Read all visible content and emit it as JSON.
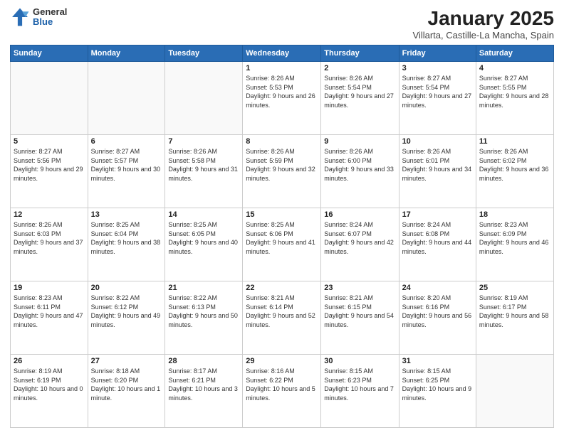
{
  "logo": {
    "general": "General",
    "blue": "Blue"
  },
  "header": {
    "month": "January 2025",
    "location": "Villarta, Castille-La Mancha, Spain"
  },
  "weekdays": [
    "Sunday",
    "Monday",
    "Tuesday",
    "Wednesday",
    "Thursday",
    "Friday",
    "Saturday"
  ],
  "weeks": [
    [
      {
        "day": "",
        "info": ""
      },
      {
        "day": "",
        "info": ""
      },
      {
        "day": "",
        "info": ""
      },
      {
        "day": "1",
        "info": "Sunrise: 8:26 AM\nSunset: 5:53 PM\nDaylight: 9 hours and 26 minutes."
      },
      {
        "day": "2",
        "info": "Sunrise: 8:26 AM\nSunset: 5:54 PM\nDaylight: 9 hours and 27 minutes."
      },
      {
        "day": "3",
        "info": "Sunrise: 8:27 AM\nSunset: 5:54 PM\nDaylight: 9 hours and 27 minutes."
      },
      {
        "day": "4",
        "info": "Sunrise: 8:27 AM\nSunset: 5:55 PM\nDaylight: 9 hours and 28 minutes."
      }
    ],
    [
      {
        "day": "5",
        "info": "Sunrise: 8:27 AM\nSunset: 5:56 PM\nDaylight: 9 hours and 29 minutes."
      },
      {
        "day": "6",
        "info": "Sunrise: 8:27 AM\nSunset: 5:57 PM\nDaylight: 9 hours and 30 minutes."
      },
      {
        "day": "7",
        "info": "Sunrise: 8:26 AM\nSunset: 5:58 PM\nDaylight: 9 hours and 31 minutes."
      },
      {
        "day": "8",
        "info": "Sunrise: 8:26 AM\nSunset: 5:59 PM\nDaylight: 9 hours and 32 minutes."
      },
      {
        "day": "9",
        "info": "Sunrise: 8:26 AM\nSunset: 6:00 PM\nDaylight: 9 hours and 33 minutes."
      },
      {
        "day": "10",
        "info": "Sunrise: 8:26 AM\nSunset: 6:01 PM\nDaylight: 9 hours and 34 minutes."
      },
      {
        "day": "11",
        "info": "Sunrise: 8:26 AM\nSunset: 6:02 PM\nDaylight: 9 hours and 36 minutes."
      }
    ],
    [
      {
        "day": "12",
        "info": "Sunrise: 8:26 AM\nSunset: 6:03 PM\nDaylight: 9 hours and 37 minutes."
      },
      {
        "day": "13",
        "info": "Sunrise: 8:25 AM\nSunset: 6:04 PM\nDaylight: 9 hours and 38 minutes."
      },
      {
        "day": "14",
        "info": "Sunrise: 8:25 AM\nSunset: 6:05 PM\nDaylight: 9 hours and 40 minutes."
      },
      {
        "day": "15",
        "info": "Sunrise: 8:25 AM\nSunset: 6:06 PM\nDaylight: 9 hours and 41 minutes."
      },
      {
        "day": "16",
        "info": "Sunrise: 8:24 AM\nSunset: 6:07 PM\nDaylight: 9 hours and 42 minutes."
      },
      {
        "day": "17",
        "info": "Sunrise: 8:24 AM\nSunset: 6:08 PM\nDaylight: 9 hours and 44 minutes."
      },
      {
        "day": "18",
        "info": "Sunrise: 8:23 AM\nSunset: 6:09 PM\nDaylight: 9 hours and 46 minutes."
      }
    ],
    [
      {
        "day": "19",
        "info": "Sunrise: 8:23 AM\nSunset: 6:11 PM\nDaylight: 9 hours and 47 minutes."
      },
      {
        "day": "20",
        "info": "Sunrise: 8:22 AM\nSunset: 6:12 PM\nDaylight: 9 hours and 49 minutes."
      },
      {
        "day": "21",
        "info": "Sunrise: 8:22 AM\nSunset: 6:13 PM\nDaylight: 9 hours and 50 minutes."
      },
      {
        "day": "22",
        "info": "Sunrise: 8:21 AM\nSunset: 6:14 PM\nDaylight: 9 hours and 52 minutes."
      },
      {
        "day": "23",
        "info": "Sunrise: 8:21 AM\nSunset: 6:15 PM\nDaylight: 9 hours and 54 minutes."
      },
      {
        "day": "24",
        "info": "Sunrise: 8:20 AM\nSunset: 6:16 PM\nDaylight: 9 hours and 56 minutes."
      },
      {
        "day": "25",
        "info": "Sunrise: 8:19 AM\nSunset: 6:17 PM\nDaylight: 9 hours and 58 minutes."
      }
    ],
    [
      {
        "day": "26",
        "info": "Sunrise: 8:19 AM\nSunset: 6:19 PM\nDaylight: 10 hours and 0 minutes."
      },
      {
        "day": "27",
        "info": "Sunrise: 8:18 AM\nSunset: 6:20 PM\nDaylight: 10 hours and 1 minute."
      },
      {
        "day": "28",
        "info": "Sunrise: 8:17 AM\nSunset: 6:21 PM\nDaylight: 10 hours and 3 minutes."
      },
      {
        "day": "29",
        "info": "Sunrise: 8:16 AM\nSunset: 6:22 PM\nDaylight: 10 hours and 5 minutes."
      },
      {
        "day": "30",
        "info": "Sunrise: 8:15 AM\nSunset: 6:23 PM\nDaylight: 10 hours and 7 minutes."
      },
      {
        "day": "31",
        "info": "Sunrise: 8:15 AM\nSunset: 6:25 PM\nDaylight: 10 hours and 9 minutes."
      },
      {
        "day": "",
        "info": ""
      }
    ]
  ]
}
